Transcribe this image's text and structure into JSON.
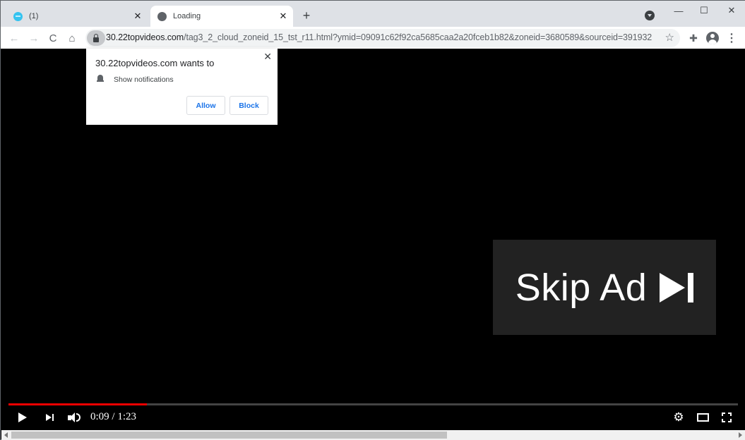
{
  "browser": {
    "tabs": [
      {
        "title": "(1)",
        "favicon": "site-favicon-blue",
        "active": false
      },
      {
        "title": "Loading",
        "favicon": "globe-icon",
        "active": true
      }
    ],
    "new_tab_label": "+",
    "tab_close_glyph": "✕",
    "window_controls": {
      "minimize": "—",
      "maximize": "☐",
      "close": "✕"
    },
    "nav": {
      "back": "←",
      "forward": "→",
      "reload": "C",
      "home": "⌂"
    },
    "address": {
      "host": "30.22topvideos.com",
      "path": "/tag3_2_cloud_zoneid_15_tst_r11.html?ymid=09091c62f92ca5685caa2a20fceb1b82&zoneid=3680589&sourceid=391932"
    },
    "toolbar_icons": [
      "star-icon",
      "extensions-icon",
      "profile-icon",
      "menu-icon"
    ],
    "star_glyph": "☆",
    "puzzle_glyph": "✚",
    "menu_glyph": "⋮"
  },
  "permission_prompt": {
    "title": "30.22topvideos.com wants to",
    "permission": "Show notifications",
    "allow_label": "Allow",
    "block_label": "Block",
    "close_glyph": "✕"
  },
  "video": {
    "skip_ad_label": "Skip Ad",
    "current_time": "0:09",
    "duration": "1:23",
    "time_display": "0:09 / 1:23",
    "played_fraction": 0.19,
    "progress_color": "#ee0000",
    "gear_glyph": "⚙"
  }
}
